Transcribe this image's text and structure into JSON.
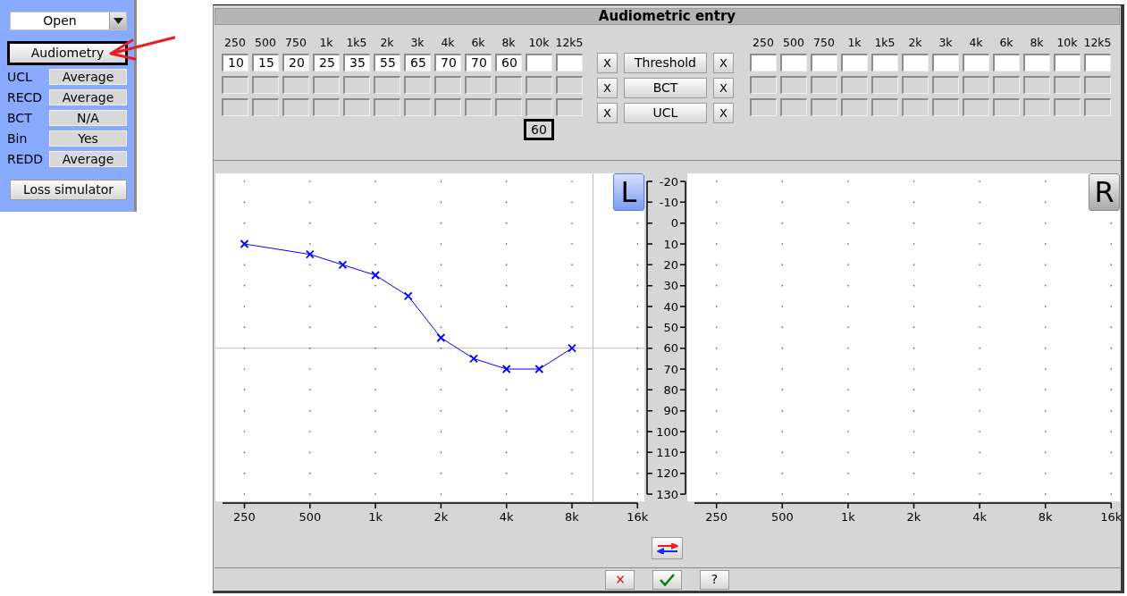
{
  "sidebar": {
    "program_select": {
      "value": "Open"
    },
    "audiometry_button": {
      "label": "Audiometry",
      "focused": true
    },
    "settings": [
      {
        "label": "UCL",
        "value": "Average"
      },
      {
        "label": "RECD",
        "value": "Average"
      },
      {
        "label": "BCT",
        "value": "N/A"
      },
      {
        "label": "Bin",
        "value": "Yes"
      },
      {
        "label": "REDD",
        "value": "Average"
      }
    ],
    "loss_simulator_button": {
      "label": "Loss simulator"
    }
  },
  "dialog": {
    "title": "Audiometric entry",
    "left_entry": {
      "frequencies": [
        "250",
        "500",
        "750",
        "1k",
        "1k5",
        "2k",
        "3k",
        "4k",
        "6k",
        "8k",
        "10k",
        "12k5"
      ],
      "rows": [
        {
          "disabled": false,
          "values": [
            "10",
            "15",
            "20",
            "25",
            "35",
            "55",
            "65",
            "70",
            "70",
            "60"
          ]
        },
        {
          "disabled": true
        },
        {
          "disabled": true
        }
      ],
      "cursor_readout": "60"
    },
    "row_controls": [
      {
        "clear_left": "X",
        "label": "Threshold",
        "clear_right": "X"
      },
      {
        "clear_left": "X",
        "label": "BCT",
        "clear_right": "X"
      },
      {
        "clear_left": "X",
        "label": "UCL",
        "clear_right": "X"
      }
    ],
    "right_entry": {
      "frequencies": [
        "250",
        "500",
        "750",
        "1k",
        "1k5",
        "2k",
        "3k",
        "4k",
        "6k",
        "8k",
        "10k",
        "12k5"
      ],
      "rows": [
        {
          "disabled": false
        },
        {
          "disabled": true
        },
        {
          "disabled": true
        }
      ]
    },
    "left_chart": {
      "ear_button": {
        "label": "L",
        "selected": true
      },
      "chart_data": {
        "type": "line",
        "categories": [
          "250",
          null,
          "500",
          null,
          "1k",
          null,
          "2k",
          null,
          "4k",
          null,
          "8k",
          null,
          "16k"
        ],
        "series": [
          {
            "color": "#0000ff",
            "marker": "x",
            "values": [
              10,
              null,
              15,
              20,
              25,
              35,
              55,
              65,
              70,
              70,
              60,
              null,
              null
            ]
          }
        ],
        "ylim": [
          130,
          -20
        ],
        "yticks": [
          -20,
          -10,
          0,
          10,
          20,
          30,
          40,
          50,
          60,
          70,
          80,
          90,
          100,
          110,
          120,
          130
        ],
        "ref_lines": [
          {
            "axis": "y",
            "value": 60
          }
        ]
      }
    },
    "right_chart": {
      "ear_button": {
        "label": "R",
        "selected": false
      },
      "chart_data": {
        "type": "line",
        "categories": [
          "250",
          null,
          "500",
          null,
          "1k",
          null,
          "2k",
          null,
          "4k",
          null,
          "8k",
          null,
          "16k"
        ],
        "ylim": [
          130,
          -20
        ]
      }
    },
    "buttons": [
      {
        "kind": "cancel"
      },
      {
        "kind": "ok"
      },
      {
        "kind": "help",
        "label": "?"
      }
    ]
  }
}
